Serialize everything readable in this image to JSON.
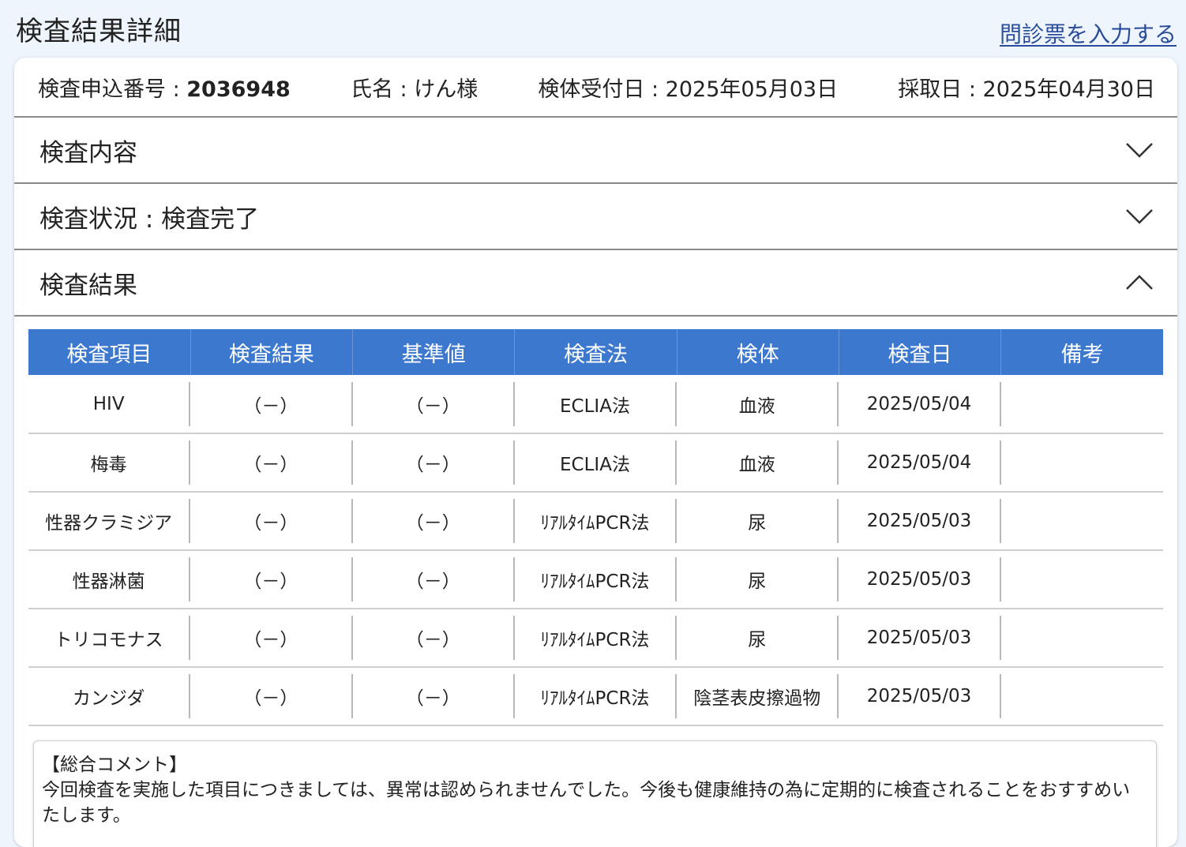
{
  "header": {
    "title": "検査結果詳細",
    "questionnaire_link": "問診票を入力する"
  },
  "info": {
    "application_label": "検査申込番号 : ",
    "application_number": "2036948",
    "name": "氏名 : けん様",
    "received_date": "検体受付日 : 2025年05月03日",
    "collection_date": "採取日 : 2025年04月30日"
  },
  "sections": {
    "content": "検査内容",
    "status": "検査状況 : 検査完了",
    "results": "検査結果"
  },
  "table": {
    "headers": [
      "検査項目",
      "検査結果",
      "基準値",
      "検査法",
      "検体",
      "検査日",
      "備考"
    ],
    "rows": [
      [
        "HIV",
        "（－）",
        "（－）",
        "ECLIA法",
        "血液",
        "2025/05/04",
        ""
      ],
      [
        "梅毒",
        "（－）",
        "（－）",
        "ECLIA法",
        "血液",
        "2025/05/04",
        ""
      ],
      [
        "性器クラミジア",
        "（－）",
        "（－）",
        "ﾘｱﾙﾀｲﾑPCR法",
        "尿",
        "2025/05/03",
        ""
      ],
      [
        "性器淋菌",
        "（－）",
        "（－）",
        "ﾘｱﾙﾀｲﾑPCR法",
        "尿",
        "2025/05/03",
        ""
      ],
      [
        "トリコモナス",
        "（－）",
        "（－）",
        "ﾘｱﾙﾀｲﾑPCR法",
        "尿",
        "2025/05/03",
        ""
      ],
      [
        "カンジダ",
        "（－）",
        "（－）",
        "ﾘｱﾙﾀｲﾑPCR法",
        "陰茎表皮擦過物",
        "2025/05/03",
        ""
      ]
    ]
  },
  "comment": {
    "heading": "【総合コメント】",
    "body": "今回検査を実施した項目につきましては、異常は認められませんでした。今後も健康維持の為に定期的に検査されることをおすすめいたします。"
  },
  "colors": {
    "table_header_bg": "#3d78cf",
    "link": "#2a4d9a",
    "page_bg": "#eef5fc"
  }
}
